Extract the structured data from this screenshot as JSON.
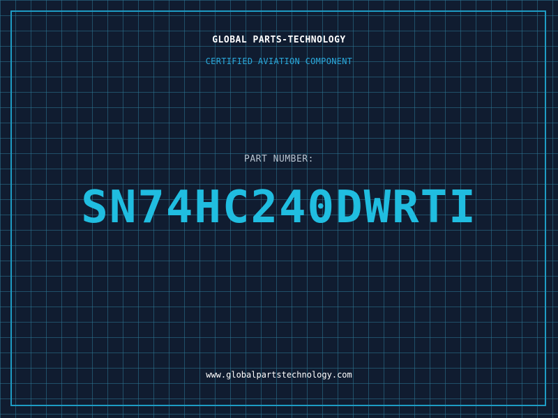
{
  "header": {
    "company": "GLOBAL PARTS-TECHNOLOGY",
    "subtitle": "CERTIFIED AVIATION COMPONENT"
  },
  "part": {
    "label": "PART NUMBER:",
    "number": "SN74HC240DWRTI"
  },
  "footer": {
    "website": "www.globalpartstechnology.com"
  },
  "colors": {
    "background": "#101c30",
    "grid": "#2e7896",
    "frame": "#1e9cc4",
    "accent": "#20bde0"
  }
}
